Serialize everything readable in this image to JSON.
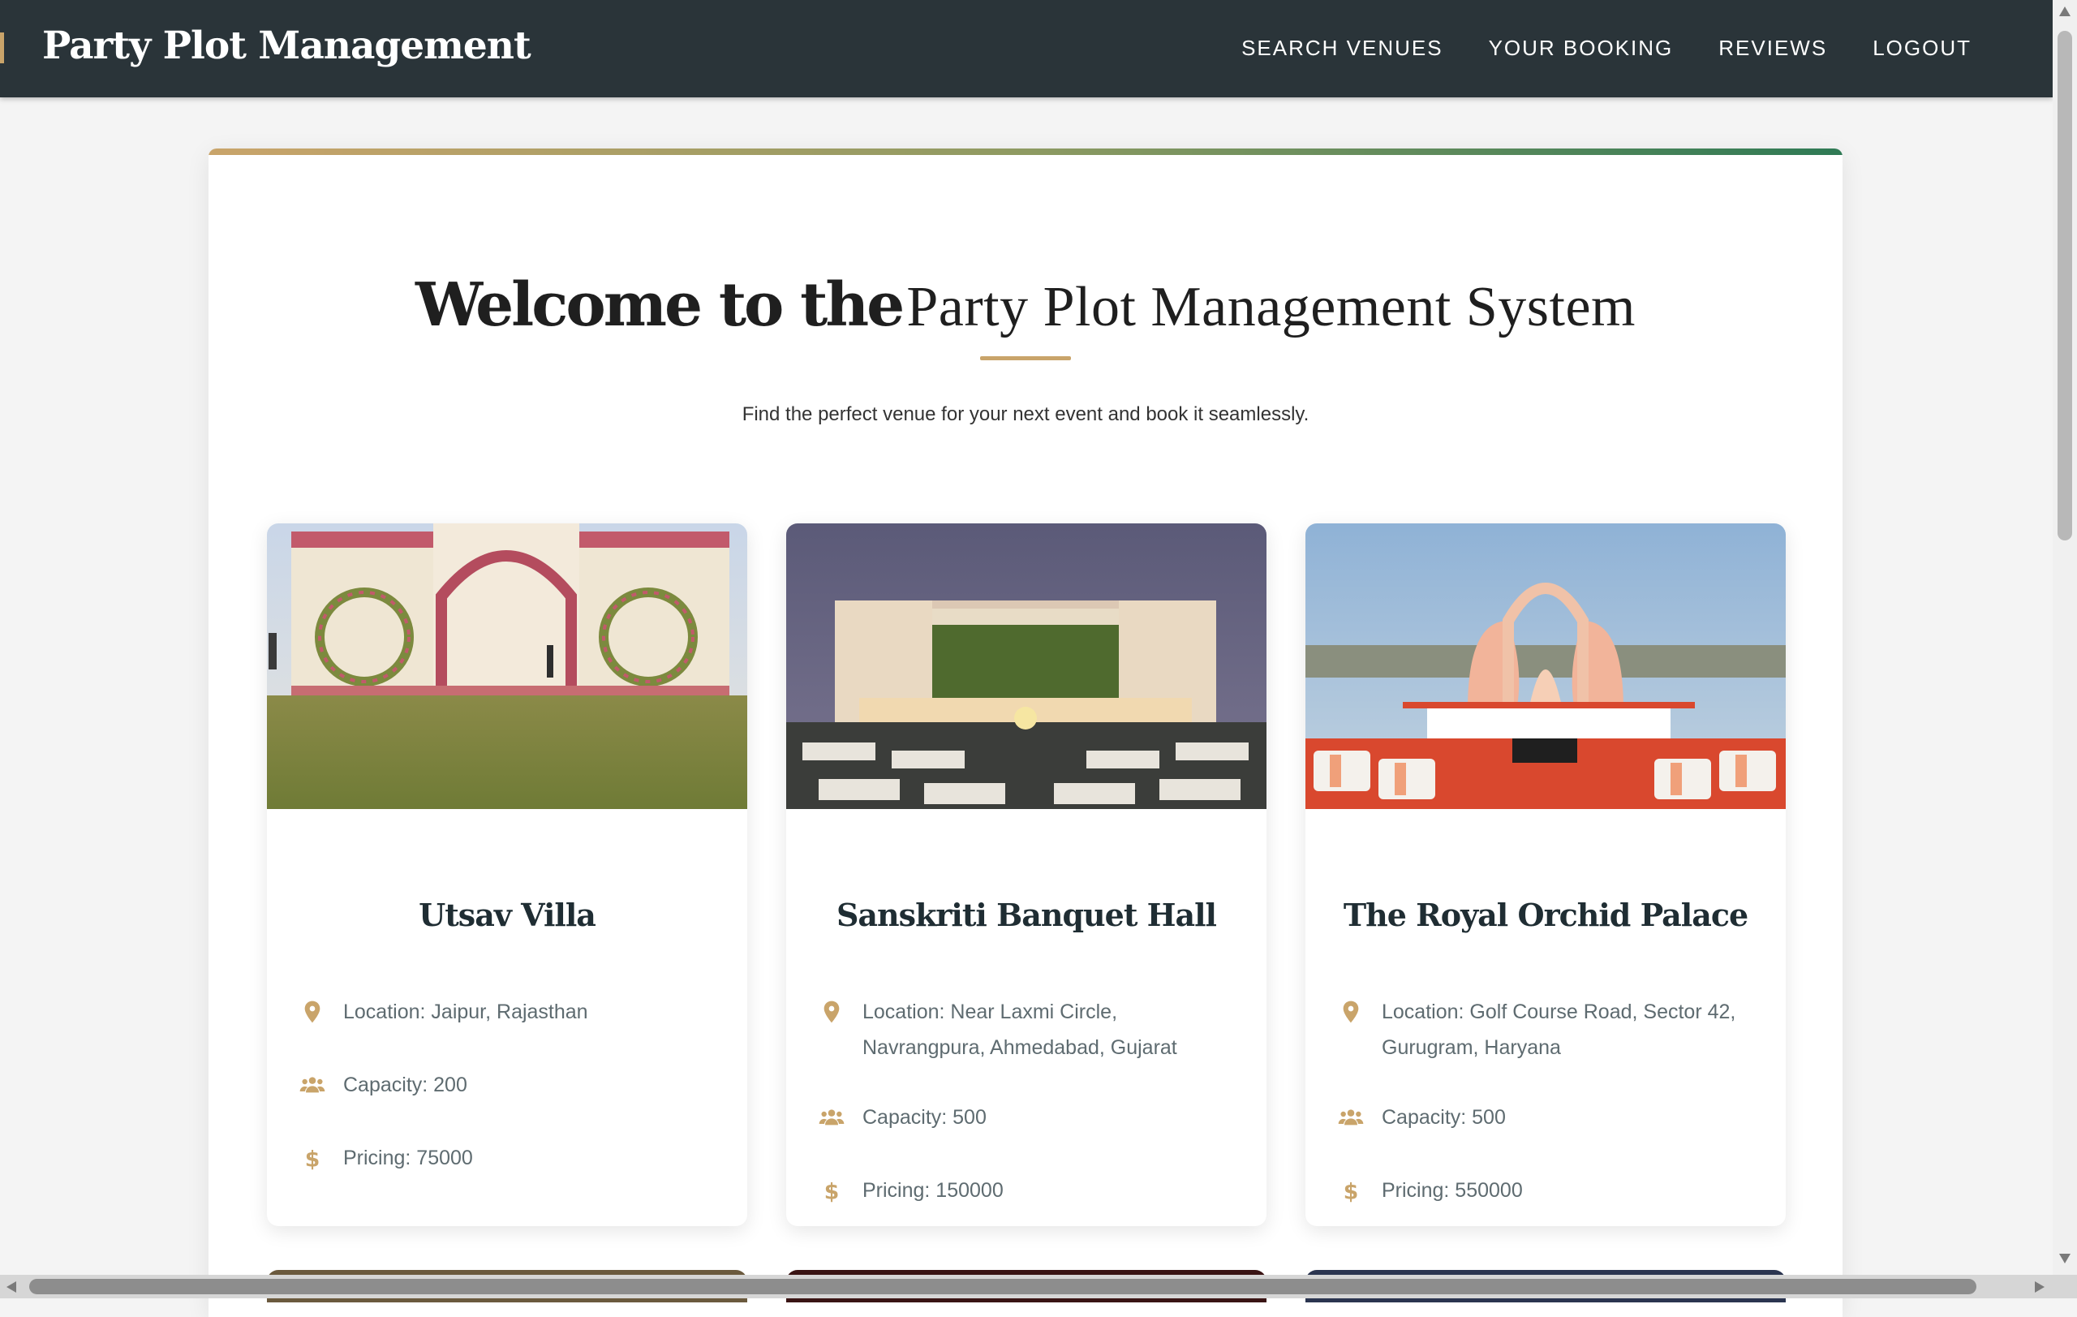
{
  "navbar": {
    "brand": "Party Plot Management",
    "links": [
      "SEARCH VENUES",
      "YOUR BOOKING",
      "REVIEWS",
      "LOGOUT"
    ]
  },
  "hero": {
    "title_bold": "Welcome to the",
    "title_light": "Party Plot Management System",
    "subtitle": "Find the perfect venue for your next event and book it seamlessly."
  },
  "venues": [
    {
      "name": "Utsav Villa",
      "location": "Location: Jaipur, Rajasthan",
      "capacity": "Capacity: 200",
      "pricing": "Pricing: 75000",
      "image_icon": "venue-photo-floral-arches"
    },
    {
      "name": "Sanskriti Banquet Hall",
      "location": "Location: Near Laxmi Circle, Navrangpura, Ahmedabad, Gujarat",
      "capacity": "Capacity: 500",
      "pricing": "Pricing: 150000",
      "image_icon": "venue-photo-night-stage"
    },
    {
      "name": "The Royal Orchid Palace",
      "location": "Location: Golf Course Road, Sector 42, Gurugram, Haryana",
      "capacity": "Capacity: 500",
      "pricing": "Pricing: 550000",
      "image_icon": "venue-photo-lotus-stage"
    }
  ],
  "colors": {
    "navbar": "#2a3439",
    "accent": "#c9a46a",
    "accent_green": "#2f7a55",
    "card_title": "#1f2d33",
    "info_text": "#5e6b70"
  },
  "icons": {
    "location": "map-pin-icon",
    "capacity": "users-icon",
    "pricing": "dollar-icon"
  }
}
